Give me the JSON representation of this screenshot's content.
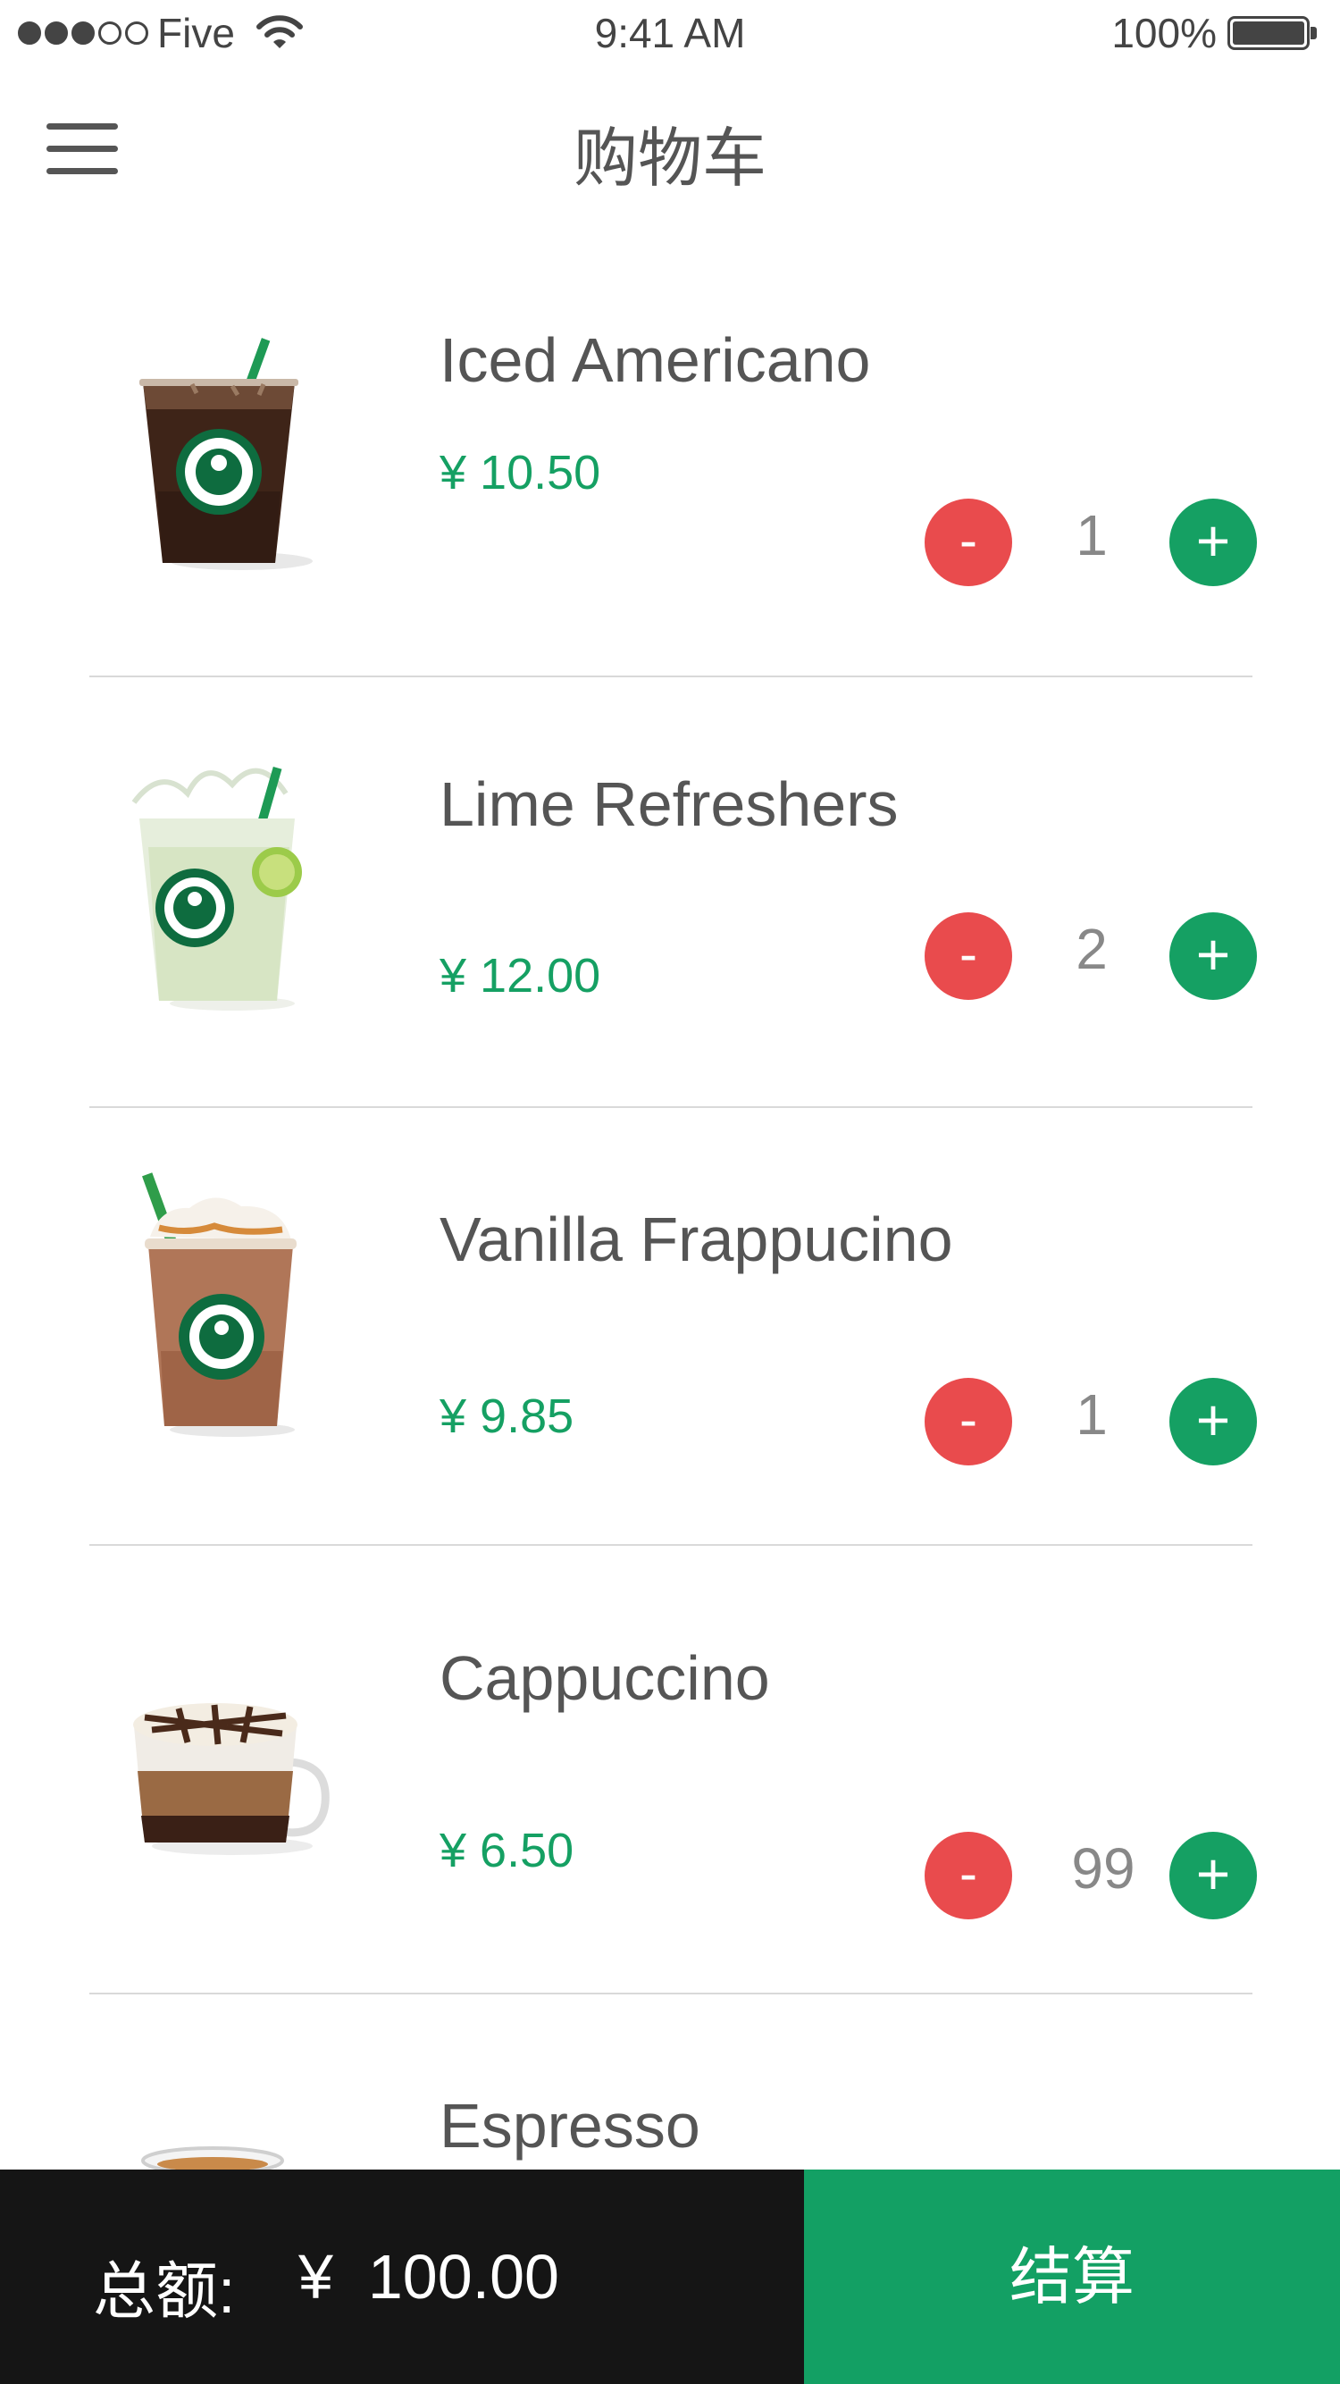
{
  "status_bar": {
    "carrier": "Five",
    "time": "9:41 AM",
    "battery": "100%",
    "battery_level": 1.0,
    "signal_strength": 3,
    "signal_max": 5,
    "icons": [
      "signal-dots",
      "wifi-icon",
      "battery-icon"
    ]
  },
  "nav": {
    "title": "购物车",
    "menu_icon": "hamburger-menu-icon"
  },
  "cart": {
    "items": [
      {
        "name": "Iced Americano",
        "price": "¥ 10.50",
        "quantity": "1",
        "image": "iced-americano-cup"
      },
      {
        "name": "Lime Refreshers",
        "price": "¥ 12.00",
        "quantity": "2",
        "image": "lime-refresher-cup"
      },
      {
        "name": "Vanilla Frappucino",
        "price": "¥ 9.85",
        "quantity": "1",
        "image": "frappuccino-cup"
      },
      {
        "name": "Cappuccino",
        "price": "¥ 6.50",
        "quantity": "99",
        "image": "cappuccino-mug"
      },
      {
        "name": "Espresso",
        "image": "espresso-cup"
      }
    ],
    "minus_label": "-",
    "plus_label": "+"
  },
  "footer": {
    "total_label": "总额:",
    "total_amount": "¥  100.00",
    "checkout_label": "结算"
  },
  "colors": {
    "accent_green": "#15a063",
    "minus_red": "#e94b4d",
    "footer_dark": "#151515",
    "text_gray": "#555555"
  }
}
